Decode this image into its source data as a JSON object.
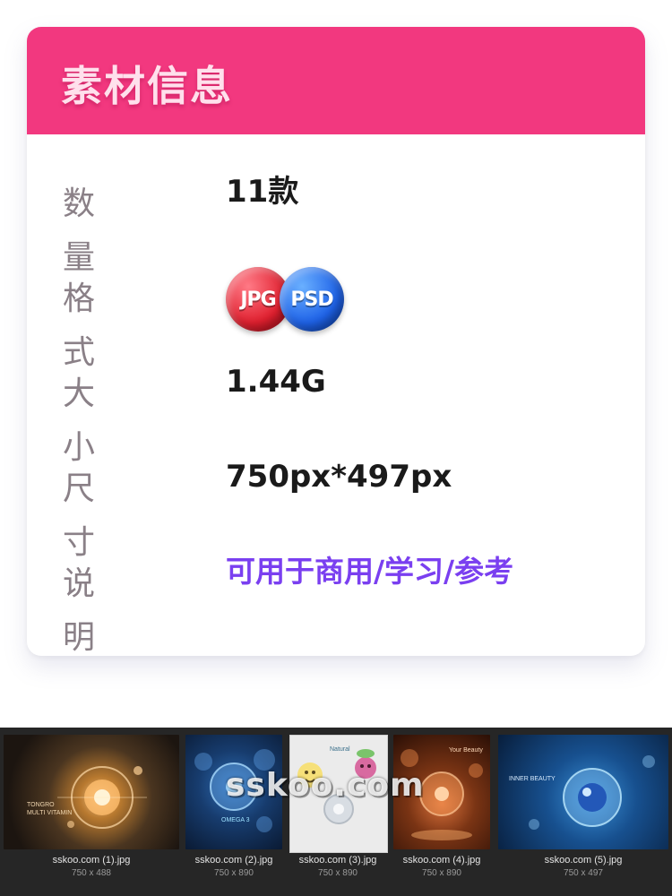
{
  "card": {
    "title": "素材信息",
    "rows": [
      {
        "label": "数量",
        "value": "11款"
      },
      {
        "label": "格式",
        "badges": [
          "JPG",
          "PSD"
        ]
      },
      {
        "label": "大小",
        "value": "1.44G"
      },
      {
        "label": "尺寸",
        "value": "750px*497px"
      },
      {
        "label": "说明",
        "value": "可用于商用/学习/参考"
      }
    ]
  },
  "colors": {
    "header": "#f2387f",
    "note_text": "#7a3ff0",
    "label_text": "#8a8087",
    "strip_background": "#262626"
  },
  "files": [
    {
      "name": "sskoo.com (1).jpg",
      "size": "750 x 488"
    },
    {
      "name": "sskoo.com (2).jpg",
      "size": "750 x 890"
    },
    {
      "name": "sskoo.com (3).jpg",
      "size": "750 x 890"
    },
    {
      "name": "sskoo.com (4).jpg",
      "size": "750 x 890"
    },
    {
      "name": "sskoo.com (5).jpg",
      "size": "750 x 497"
    }
  ],
  "thumbnails": [
    {
      "caption_line1": "TONGRO",
      "caption_line2": "MULTI VITAMIN"
    },
    {
      "caption_line1": "OMEGA 3"
    },
    {
      "caption_line1": "Natural"
    },
    {
      "caption_line1": "Your Beauty"
    },
    {
      "caption_line1": "INNER BEAUTY"
    }
  ],
  "watermark": "sskoo.com"
}
